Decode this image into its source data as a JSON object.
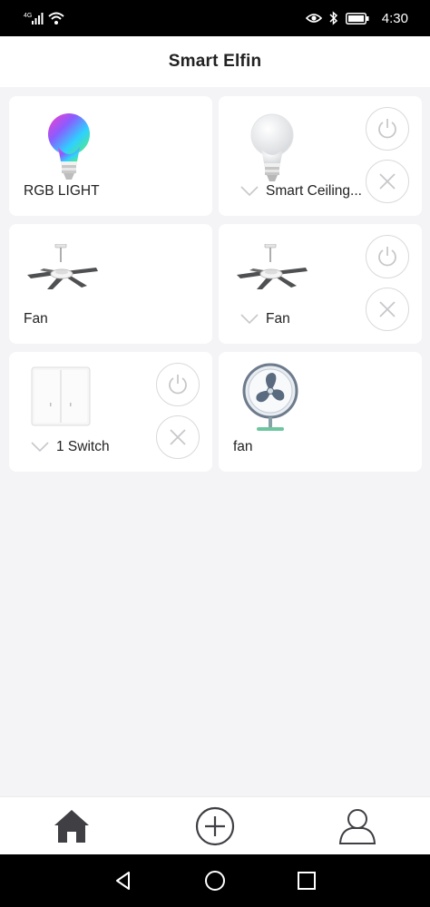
{
  "status_bar": {
    "network": "4G",
    "time": "4:30"
  },
  "header": {
    "title": "Smart Elfin"
  },
  "devices": [
    {
      "name": "RGB LIGHT",
      "icon": "rgb-bulb-icon",
      "has_actions": false
    },
    {
      "name": "Smart Ceiling...",
      "icon": "white-bulb-icon",
      "has_actions": true
    },
    {
      "name": "Fan",
      "icon": "ceiling-fan-icon",
      "has_actions": false
    },
    {
      "name": "Fan",
      "icon": "ceiling-fan-icon",
      "has_actions": true
    },
    {
      "name": "1 Switch",
      "icon": "wall-switch-icon",
      "has_actions": true
    },
    {
      "name": "fan",
      "icon": "desk-fan-icon",
      "has_actions": false
    }
  ],
  "bottom_nav": [
    "home-icon",
    "add-icon",
    "profile-icon"
  ],
  "colors": {
    "background": "#f4f4f7",
    "card": "#ffffff",
    "text": "#222222",
    "muted": "#c8c8cc"
  }
}
